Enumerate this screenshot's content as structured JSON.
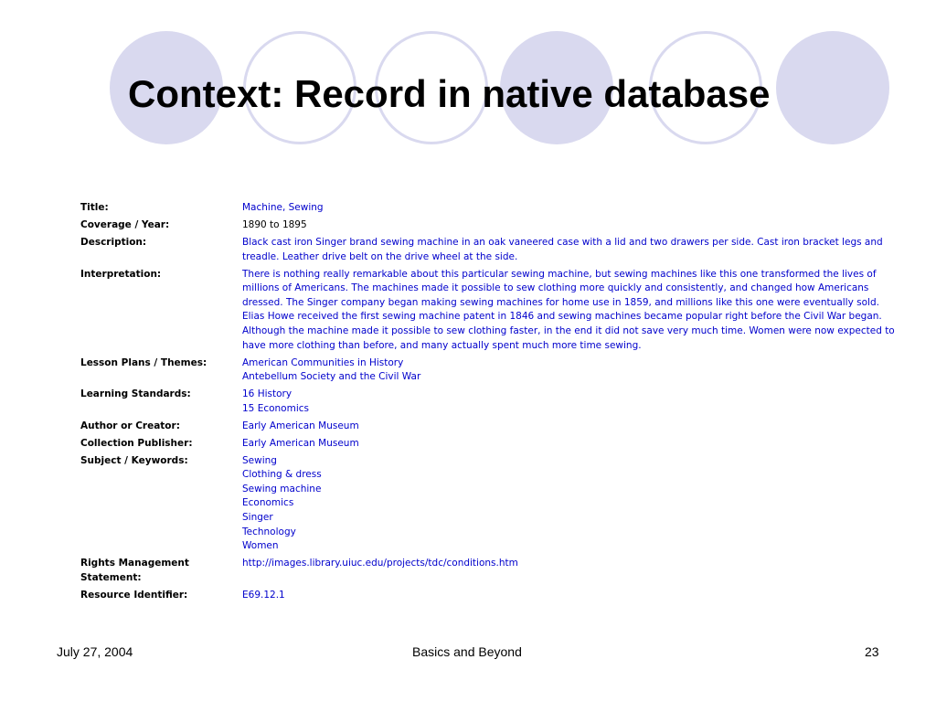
{
  "slide": {
    "title": "Context: Record in native database",
    "footer": {
      "date": "July 27, 2004",
      "center": "Basics and Beyond",
      "page": "23"
    }
  },
  "record": {
    "title": {
      "label": "Title:",
      "value": "Machine, Sewing"
    },
    "coverage": {
      "label": "Coverage / Year:",
      "value": "1890 to 1895"
    },
    "description": {
      "label": "Description:",
      "value": "Black cast iron Singer brand sewing machine in an oak vaneered case with a lid and two drawers per side. Cast iron bracket legs and treadle. Leather drive belt on the drive wheel at the side."
    },
    "interpretation": {
      "label": "Interpretation:",
      "value": "There is nothing really remarkable about this particular sewing machine, but sewing machines like this one transformed the lives of millions of Americans. The machines made it possible to sew clothing more quickly and consistently, and changed how Americans dressed. The Singer company began making sewing machines for home use in 1859, and millions like this one were eventually sold. Elias Howe received the first sewing machine patent in 1846 and sewing machines became popular right before the Civil War began. Although the machine made it possible to sew clothing faster, in the end it did not save very much time. Women were now expected to have more clothing than before, and many actually spent much more time sewing."
    },
    "lesson_plans": {
      "label": "Lesson Plans / Themes:",
      "values": [
        "American Communities in History",
        "Antebellum Society and the Civil War"
      ]
    },
    "learning_standards": {
      "label": "Learning Standards:",
      "values": [
        "16 History",
        "15 Economics"
      ]
    },
    "author": {
      "label": "Author or Creator:",
      "value": "Early American Museum"
    },
    "publisher": {
      "label": "Collection Publisher:",
      "value": "Early American Museum"
    },
    "subjects": {
      "label": "Subject / Keywords:",
      "values": [
        "Sewing",
        "Clothing & dress",
        "Sewing machine",
        "Economics",
        "Singer",
        "Technology",
        "Women"
      ]
    },
    "rights": {
      "label_lines": [
        "Rights Management",
        "Statement:"
      ],
      "value": "http://images.library.uiuc.edu/projects/tdc/conditions.htm"
    },
    "identifier": {
      "label": "Resource Identifier:",
      "value": "E69.12.1"
    }
  },
  "colors": {
    "circle": "#d9d9ef",
    "link": "#0000cc",
    "text": "#000000"
  }
}
